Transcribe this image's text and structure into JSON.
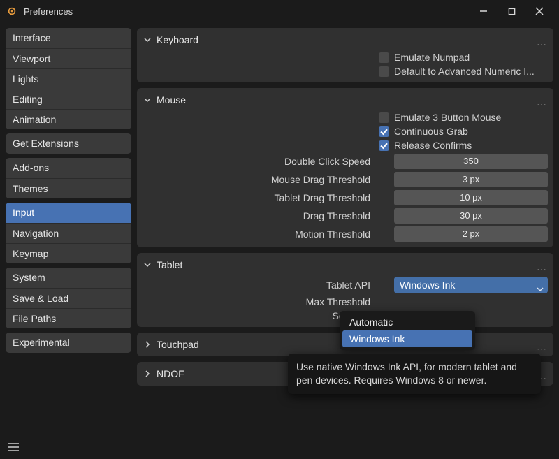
{
  "window": {
    "title": "Preferences"
  },
  "sidebar": {
    "groups": [
      {
        "items": [
          "Interface",
          "Viewport",
          "Lights",
          "Editing",
          "Animation"
        ]
      },
      {
        "items": [
          "Get Extensions"
        ]
      },
      {
        "items": [
          "Add-ons",
          "Themes"
        ]
      },
      {
        "items": [
          "Input",
          "Navigation",
          "Keymap"
        ],
        "activeIndex": 0
      },
      {
        "items": [
          "System",
          "Save & Load",
          "File Paths"
        ]
      },
      {
        "items": [
          "Experimental"
        ]
      }
    ]
  },
  "sections": {
    "keyboard": {
      "title": "Keyboard",
      "checkboxes": [
        {
          "label": "Emulate Numpad",
          "checked": false
        },
        {
          "label": "Default to Advanced Numeric I...",
          "checked": false
        }
      ]
    },
    "mouse": {
      "title": "Mouse",
      "checkboxes": [
        {
          "label": "Emulate 3 Button Mouse",
          "checked": false
        },
        {
          "label": "Continuous Grab",
          "checked": true
        },
        {
          "label": "Release Confirms",
          "checked": true
        }
      ],
      "values": [
        {
          "label": "Double Click Speed",
          "value": "350"
        },
        {
          "label": "Mouse Drag Threshold",
          "value": "3 px"
        },
        {
          "label": "Tablet Drag Threshold",
          "value": "10 px"
        },
        {
          "label": "Drag Threshold",
          "value": "30 px"
        },
        {
          "label": "Motion Threshold",
          "value": "2 px"
        }
      ]
    },
    "tablet": {
      "title": "Tablet",
      "api_label": "Tablet API",
      "api_value": "Windows Ink",
      "options": [
        "Automatic",
        "Windows Ink"
      ],
      "options_highlight": 1,
      "sliders": [
        {
          "label": "Max Threshold"
        },
        {
          "label": "Softness"
        }
      ],
      "tooltip": "Use native Windows Ink API, for modern tablet and pen devices. Requires Windows 8 or newer."
    },
    "touchpad": {
      "title": "Touchpad"
    },
    "ndof": {
      "title": "NDOF"
    }
  }
}
